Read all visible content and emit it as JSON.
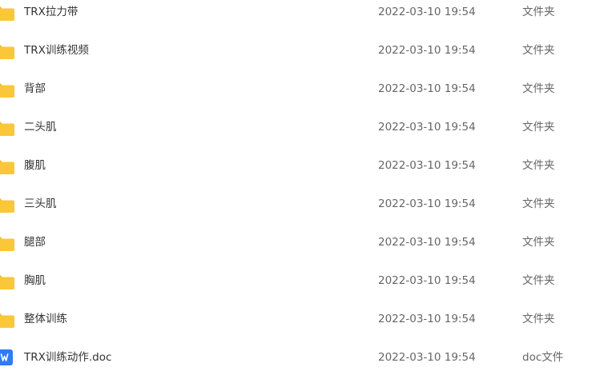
{
  "files": [
    {
      "name": "TRX拉力带",
      "modified": "2022-03-10 19:54",
      "type": "文件夹",
      "icon": "folder-icon"
    },
    {
      "name": "TRX训练视频",
      "modified": "2022-03-10 19:54",
      "type": "文件夹",
      "icon": "folder-icon"
    },
    {
      "name": "背部",
      "modified": "2022-03-10 19:54",
      "type": "文件夹",
      "icon": "folder-icon"
    },
    {
      "name": "二头肌",
      "modified": "2022-03-10 19:54",
      "type": "文件夹",
      "icon": "folder-icon"
    },
    {
      "name": "腹肌",
      "modified": "2022-03-10 19:54",
      "type": "文件夹",
      "icon": "folder-icon"
    },
    {
      "name": "三头肌",
      "modified": "2022-03-10 19:54",
      "type": "文件夹",
      "icon": "folder-icon"
    },
    {
      "name": "腿部",
      "modified": "2022-03-10 19:54",
      "type": "文件夹",
      "icon": "folder-icon"
    },
    {
      "name": "胸肌",
      "modified": "2022-03-10 19:54",
      "type": "文件夹",
      "icon": "folder-icon"
    },
    {
      "name": "整体训练",
      "modified": "2022-03-10 19:54",
      "type": "文件夹",
      "icon": "folder-icon"
    },
    {
      "name": "TRX训练动作.doc",
      "modified": "2022-03-10 19:54",
      "type": "doc文件",
      "icon": "word-doc-icon"
    }
  ],
  "colors": {
    "folder": "#F9C738",
    "folder_tab": "#F2B81E",
    "doc": "#2F7CF6"
  }
}
